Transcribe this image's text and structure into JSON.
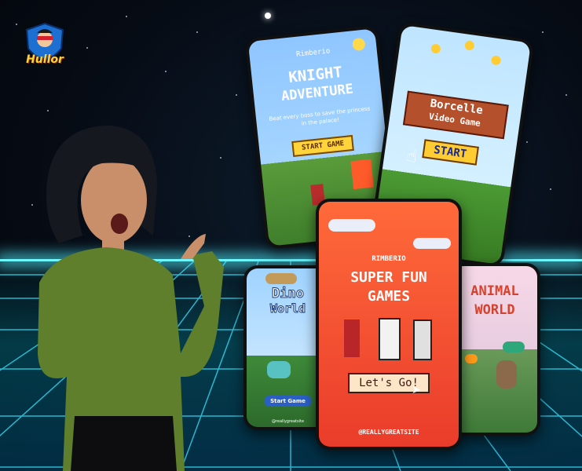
{
  "logo": {
    "text": "Hullor"
  },
  "cards": {
    "knight": {
      "brand": "Rimberio",
      "title_line1": "KNIGHT",
      "title_line2": "ADVENTURE",
      "subtitle": "Beat every boss to save the princess in the palace!",
      "button": "START GAME"
    },
    "borcelle": {
      "title_line1": "Borcelle",
      "title_line2": "Video Game",
      "button": "START"
    },
    "dino": {
      "title_line1": "Dino",
      "title_line2": "World",
      "button": "Start Game",
      "handle": "@reallygreatsite"
    },
    "superfun": {
      "brand": "RIMBERIO",
      "title_line1": "SUPER FUN",
      "title_line2": "GAMES",
      "button": "Let's Go!",
      "handle": "@REALLYGREATSITE"
    },
    "animal": {
      "title_line1": "ANIMAL",
      "title_line2": "WORLD"
    }
  }
}
